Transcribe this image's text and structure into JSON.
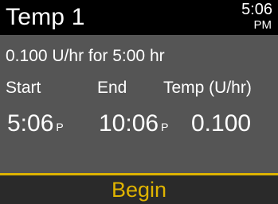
{
  "header": {
    "title": "Temp 1",
    "time": "5:06",
    "ampm": "PM"
  },
  "summary": "0.100 U/hr for 5:00 hr",
  "columns": {
    "start_label": "Start",
    "end_label": "End",
    "temp_label": "Temp (U/hr)"
  },
  "values": {
    "start": "5:06",
    "start_suffix": "P",
    "end": "10:06",
    "end_suffix": "P",
    "temp": "0.100"
  },
  "footer": {
    "action_label": "Begin"
  },
  "colors": {
    "header_bg": "#000000",
    "body_bg": "#555555",
    "accent": "#e0b400",
    "footer_bg": "#2a2a2a"
  }
}
